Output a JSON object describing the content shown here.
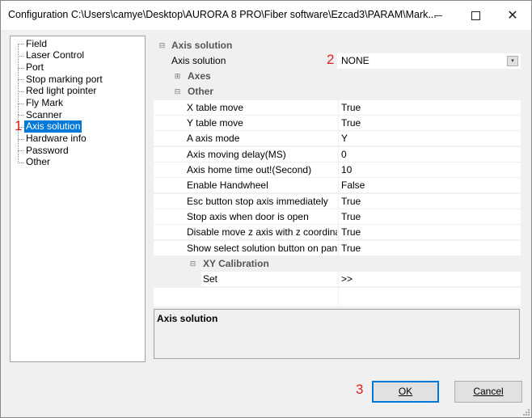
{
  "window": {
    "title": "Configuration C:\\Users\\camye\\Desktop\\AURORA 8 PRO\\Fiber software\\Ezcad3\\PARAM\\Mark...",
    "close_glyph": "✕"
  },
  "tree": {
    "items": [
      {
        "label": "Field"
      },
      {
        "label": "Laser Control"
      },
      {
        "label": "Port"
      },
      {
        "label": "Stop marking port"
      },
      {
        "label": "Red light pointer"
      },
      {
        "label": "Fly Mark"
      },
      {
        "label": "Scanner"
      },
      {
        "label": "Axis solution",
        "selected": true
      },
      {
        "label": "Hardware info"
      },
      {
        "label": "Password"
      },
      {
        "label": "Other"
      }
    ]
  },
  "grid": {
    "category_axis_solution": "Axis solution",
    "axis_solution_label": "Axis solution",
    "axis_solution_value": "NONE",
    "category_axes": "Axes",
    "category_other": "Other",
    "other_props": [
      {
        "name": "X table move",
        "value": "True"
      },
      {
        "name": "Y table move",
        "value": "True"
      },
      {
        "name": "A axis mode",
        "value": "Y"
      },
      {
        "name": "Axis moving delay(MS)",
        "value": "0"
      },
      {
        "name": "Axis home time out!(Second)",
        "value": "10"
      },
      {
        "name": "Enable Handwheel",
        "value": "False"
      },
      {
        "name": "Esc button stop axis immediately",
        "value": "True"
      },
      {
        "name": "Stop axis when door is open",
        "value": "True"
      },
      {
        "name": "Disable move z axis with z coordinate",
        "value": "True"
      },
      {
        "name": "Show select solution button on panel",
        "value": "True"
      }
    ],
    "category_xy_calibration": "XY Calibration",
    "set_label": "Set",
    "set_value": ">>"
  },
  "description": {
    "title": "Axis solution"
  },
  "annotations": {
    "one": "1",
    "two": "2",
    "three": "3",
    "color": "#e02020"
  },
  "buttons": {
    "ok": "OK",
    "cancel": "Cancel"
  },
  "colors": {
    "selection": "#0078d7",
    "window_bg": "#f0f0f0"
  }
}
